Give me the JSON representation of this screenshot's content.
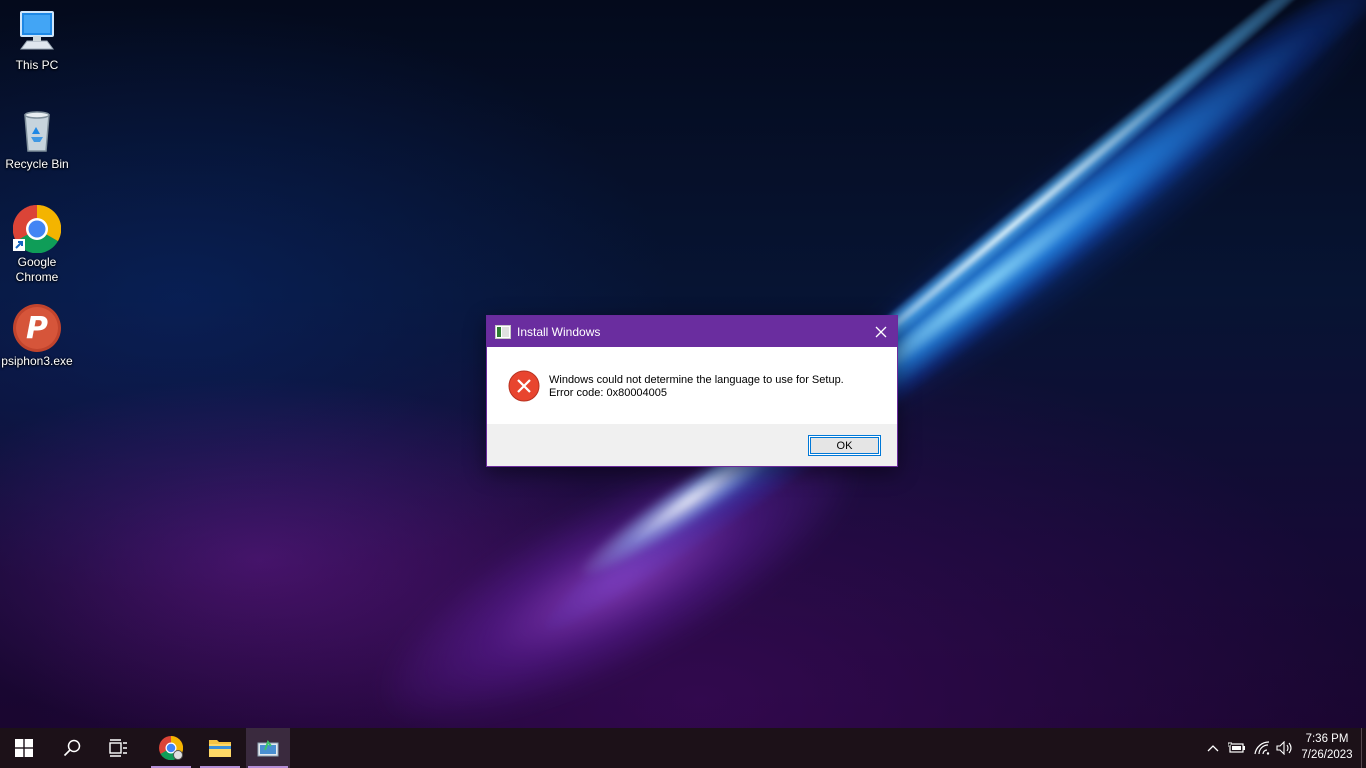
{
  "desktop": {
    "icons": [
      {
        "label": "This PC",
        "icon": "computer-icon"
      },
      {
        "label": "Recycle Bin",
        "icon": "recycle-bin-icon"
      },
      {
        "label": "Google Chrome",
        "icon": "chrome-icon"
      },
      {
        "label": "psiphon3.exe",
        "icon": "psiphon-icon"
      }
    ]
  },
  "dialog": {
    "title": "Install Windows",
    "message_line1": "Windows could not determine the language to use for Setup.",
    "message_line2": "Error code: 0x80004005",
    "ok_label": "OK",
    "title_bar_color": "#6a2d9f"
  },
  "taskbar": {
    "items": [
      "windows-start-icon",
      "search-icon",
      "task-view-icon",
      "chrome-icon",
      "file-explorer-icon",
      "windows-setup-icon"
    ],
    "tray_icons": [
      "chevron-up-icon",
      "battery-icon",
      "wifi-icon",
      "volume-icon"
    ],
    "time": "7:36 PM",
    "date": "7/26/2023"
  }
}
